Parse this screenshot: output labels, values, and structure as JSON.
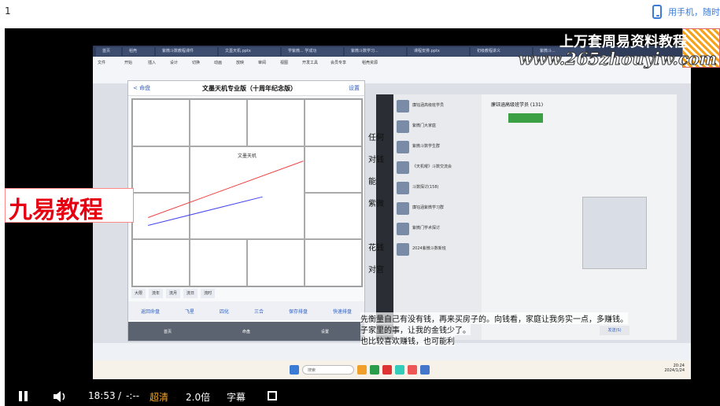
{
  "page": {
    "number": "1",
    "phone_link": "用手机，随时"
  },
  "video": {
    "tabs": [
      "首页",
      "稻壳",
      "紫微斗数教程课件",
      "文墨天机.pptx",
      "学紫微... 学成功",
      "紫微斗数学习...",
      "课程安排.pptx",
      "初级教程讲义",
      "紫微斗..."
    ],
    "ribbon": [
      "文件",
      "开始",
      "插入",
      "设计",
      "切换",
      "动画",
      "放映",
      "审阅",
      "视图",
      "开发工具",
      "会员专享",
      "稻壳资源"
    ],
    "app_title": "文墨天机专业版（十周年纪念版）",
    "app_back": "< 命盘",
    "app_settings": "设置",
    "center_name": "文墨天机",
    "app_tabs": [
      "大限",
      "流年",
      "流月",
      "流日",
      "流时"
    ],
    "app_bottom": [
      "返回命盘",
      "飞星",
      "四化",
      "三合",
      "保存排盘",
      "快速排盘"
    ],
    "app_nav": [
      "首页",
      "命盘",
      "设置"
    ],
    "chat_title": "廉钰涵高级班学员 (131)",
    "chat_items": [
      "廉钰涵高级班学员",
      "紫微门大家庭",
      "紫微斗数学生群",
      "《天机曜》斗数交流会",
      "斗数探讨(158)",
      "廉钰涵紫微学习群",
      "紫微门学术探讨",
      "2024紫微斗数新班"
    ],
    "chat_send": "发送(S)",
    "watermark_cn": "上万套周易资料教程",
    "watermark_url": "www.265zhouyiw.com",
    "brand": "九易教程",
    "overlay_lines": [
      "任何",
      "对钱",
      "能",
      "紫微",
      "花钱",
      "对宫",
      "先衡量自己有没有钱，再来买房子的。向钱看，家庭让我务实一点，多赚钱。",
      "子家里的事，让我的金钱少了。",
      "也比较喜欢赚钱，也可能利"
    ],
    "taskbar_search": "搜索",
    "clock_time": "20:24",
    "clock_date": "2024/1/24"
  },
  "controls": {
    "time": "18:53",
    "separator": "/",
    "duration": "-:--",
    "quality": "超清",
    "speed": "2.0倍",
    "subtitle": "字幕"
  },
  "colors": {
    "quality_color": "#f5a623",
    "link_color": "#3b7bd8"
  }
}
